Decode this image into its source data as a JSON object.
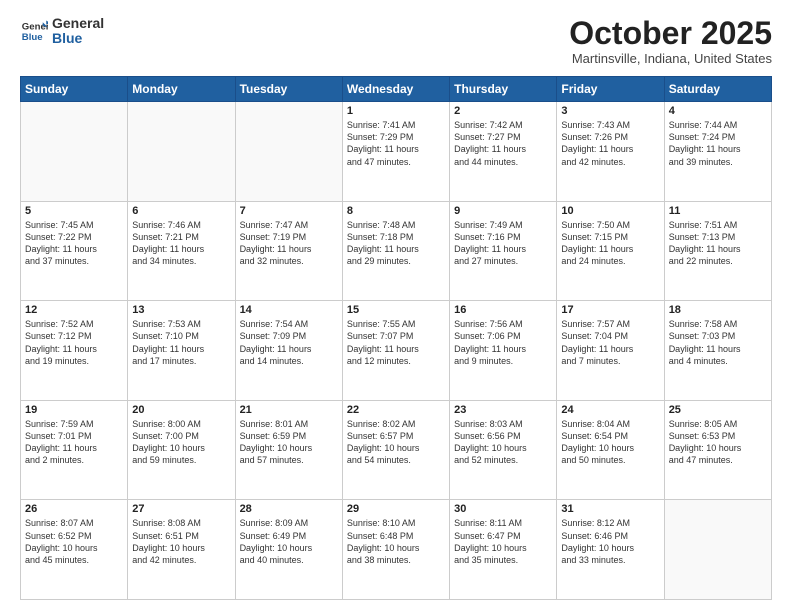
{
  "logo": {
    "general": "General",
    "blue": "Blue"
  },
  "header": {
    "month": "October 2025",
    "location": "Martinsville, Indiana, United States"
  },
  "weekdays": [
    "Sunday",
    "Monday",
    "Tuesday",
    "Wednesday",
    "Thursday",
    "Friday",
    "Saturday"
  ],
  "weeks": [
    [
      {
        "day": "",
        "info": ""
      },
      {
        "day": "",
        "info": ""
      },
      {
        "day": "",
        "info": ""
      },
      {
        "day": "1",
        "info": "Sunrise: 7:41 AM\nSunset: 7:29 PM\nDaylight: 11 hours\nand 47 minutes."
      },
      {
        "day": "2",
        "info": "Sunrise: 7:42 AM\nSunset: 7:27 PM\nDaylight: 11 hours\nand 44 minutes."
      },
      {
        "day": "3",
        "info": "Sunrise: 7:43 AM\nSunset: 7:26 PM\nDaylight: 11 hours\nand 42 minutes."
      },
      {
        "day": "4",
        "info": "Sunrise: 7:44 AM\nSunset: 7:24 PM\nDaylight: 11 hours\nand 39 minutes."
      }
    ],
    [
      {
        "day": "5",
        "info": "Sunrise: 7:45 AM\nSunset: 7:22 PM\nDaylight: 11 hours\nand 37 minutes."
      },
      {
        "day": "6",
        "info": "Sunrise: 7:46 AM\nSunset: 7:21 PM\nDaylight: 11 hours\nand 34 minutes."
      },
      {
        "day": "7",
        "info": "Sunrise: 7:47 AM\nSunset: 7:19 PM\nDaylight: 11 hours\nand 32 minutes."
      },
      {
        "day": "8",
        "info": "Sunrise: 7:48 AM\nSunset: 7:18 PM\nDaylight: 11 hours\nand 29 minutes."
      },
      {
        "day": "9",
        "info": "Sunrise: 7:49 AM\nSunset: 7:16 PM\nDaylight: 11 hours\nand 27 minutes."
      },
      {
        "day": "10",
        "info": "Sunrise: 7:50 AM\nSunset: 7:15 PM\nDaylight: 11 hours\nand 24 minutes."
      },
      {
        "day": "11",
        "info": "Sunrise: 7:51 AM\nSunset: 7:13 PM\nDaylight: 11 hours\nand 22 minutes."
      }
    ],
    [
      {
        "day": "12",
        "info": "Sunrise: 7:52 AM\nSunset: 7:12 PM\nDaylight: 11 hours\nand 19 minutes."
      },
      {
        "day": "13",
        "info": "Sunrise: 7:53 AM\nSunset: 7:10 PM\nDaylight: 11 hours\nand 17 minutes."
      },
      {
        "day": "14",
        "info": "Sunrise: 7:54 AM\nSunset: 7:09 PM\nDaylight: 11 hours\nand 14 minutes."
      },
      {
        "day": "15",
        "info": "Sunrise: 7:55 AM\nSunset: 7:07 PM\nDaylight: 11 hours\nand 12 minutes."
      },
      {
        "day": "16",
        "info": "Sunrise: 7:56 AM\nSunset: 7:06 PM\nDaylight: 11 hours\nand 9 minutes."
      },
      {
        "day": "17",
        "info": "Sunrise: 7:57 AM\nSunset: 7:04 PM\nDaylight: 11 hours\nand 7 minutes."
      },
      {
        "day": "18",
        "info": "Sunrise: 7:58 AM\nSunset: 7:03 PM\nDaylight: 11 hours\nand 4 minutes."
      }
    ],
    [
      {
        "day": "19",
        "info": "Sunrise: 7:59 AM\nSunset: 7:01 PM\nDaylight: 11 hours\nand 2 minutes."
      },
      {
        "day": "20",
        "info": "Sunrise: 8:00 AM\nSunset: 7:00 PM\nDaylight: 10 hours\nand 59 minutes."
      },
      {
        "day": "21",
        "info": "Sunrise: 8:01 AM\nSunset: 6:59 PM\nDaylight: 10 hours\nand 57 minutes."
      },
      {
        "day": "22",
        "info": "Sunrise: 8:02 AM\nSunset: 6:57 PM\nDaylight: 10 hours\nand 54 minutes."
      },
      {
        "day": "23",
        "info": "Sunrise: 8:03 AM\nSunset: 6:56 PM\nDaylight: 10 hours\nand 52 minutes."
      },
      {
        "day": "24",
        "info": "Sunrise: 8:04 AM\nSunset: 6:54 PM\nDaylight: 10 hours\nand 50 minutes."
      },
      {
        "day": "25",
        "info": "Sunrise: 8:05 AM\nSunset: 6:53 PM\nDaylight: 10 hours\nand 47 minutes."
      }
    ],
    [
      {
        "day": "26",
        "info": "Sunrise: 8:07 AM\nSunset: 6:52 PM\nDaylight: 10 hours\nand 45 minutes."
      },
      {
        "day": "27",
        "info": "Sunrise: 8:08 AM\nSunset: 6:51 PM\nDaylight: 10 hours\nand 42 minutes."
      },
      {
        "day": "28",
        "info": "Sunrise: 8:09 AM\nSunset: 6:49 PM\nDaylight: 10 hours\nand 40 minutes."
      },
      {
        "day": "29",
        "info": "Sunrise: 8:10 AM\nSunset: 6:48 PM\nDaylight: 10 hours\nand 38 minutes."
      },
      {
        "day": "30",
        "info": "Sunrise: 8:11 AM\nSunset: 6:47 PM\nDaylight: 10 hours\nand 35 minutes."
      },
      {
        "day": "31",
        "info": "Sunrise: 8:12 AM\nSunset: 6:46 PM\nDaylight: 10 hours\nand 33 minutes."
      },
      {
        "day": "",
        "info": ""
      }
    ]
  ]
}
